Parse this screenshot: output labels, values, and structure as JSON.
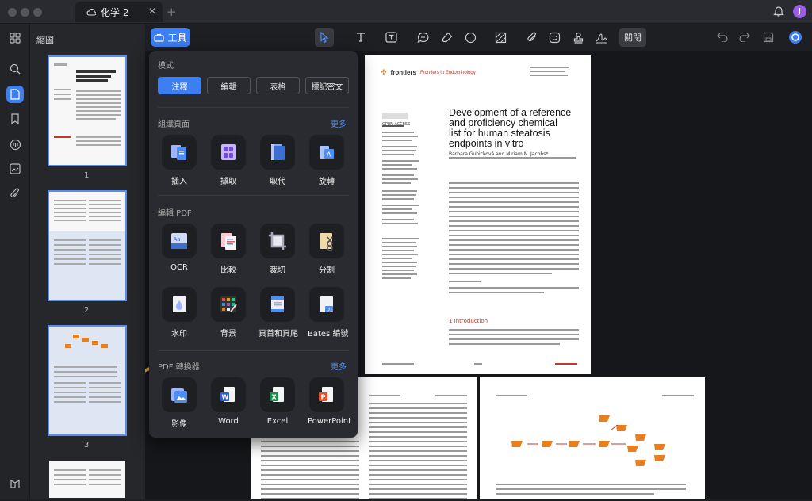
{
  "tab": {
    "title": "化学 2"
  },
  "avatar": {
    "initial": "J"
  },
  "toolbar": {
    "tools_label": "工具",
    "close_label": "關閉"
  },
  "thumbnails": {
    "title": "縮圖",
    "pages": [
      "1",
      "2",
      "3"
    ]
  },
  "panel": {
    "mode_title": "模式",
    "modes": [
      "注釋",
      "編輯",
      "表格",
      "標記密文"
    ],
    "organize_title": "組織頁面",
    "organize_more": "更多",
    "organize_items": [
      "插入",
      "擷取",
      "取代",
      "旋轉"
    ],
    "edit_title": "編輯 PDF",
    "edit_items": [
      "OCR",
      "比較",
      "裁切",
      "分割",
      "水印",
      "背景",
      "頁首和頁尾",
      "Bates 編號"
    ],
    "convert_title": "PDF 轉換器",
    "convert_more": "更多",
    "convert_items": [
      "影像",
      "Word",
      "Excel",
      "PowerPoint"
    ]
  },
  "document": {
    "brand": "frontiers",
    "journal": "Frontiers in Endocrinology",
    "title_line1": "Development of a reference",
    "title_line2": "and proficiency chemical",
    "title_line3": "list for human steatosis",
    "title_line4": "endpoints in vitro",
    "authors": "Barbara Gubicková and Miriam N. Jacobs*",
    "section": "1 Introduction",
    "open_access": "OPEN ACCESS"
  },
  "colors": {
    "accent": "#3d7ff0",
    "arrow": "#f5a623",
    "section_red": "#c0392b"
  }
}
